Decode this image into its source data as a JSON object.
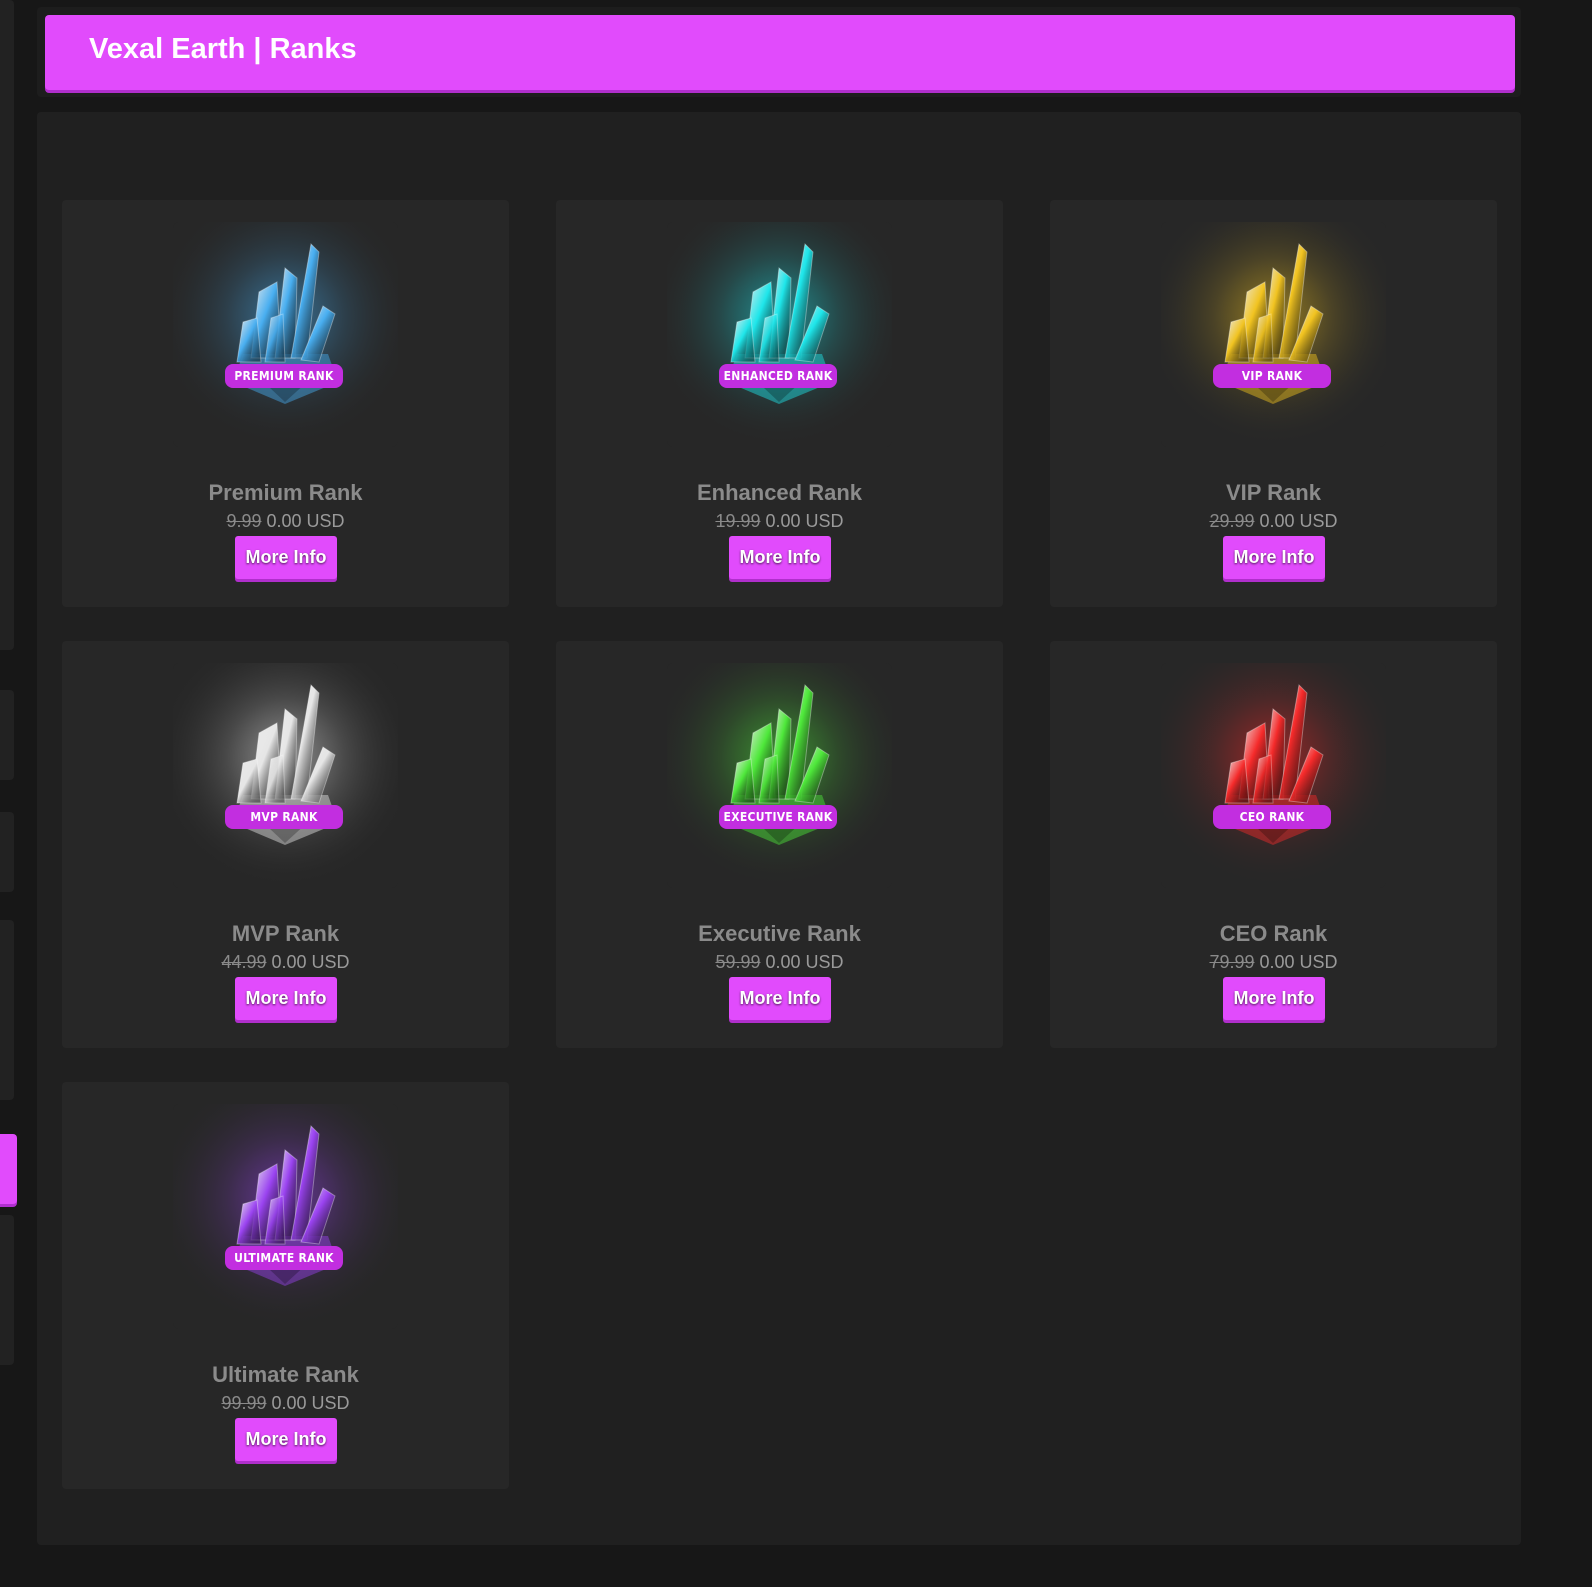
{
  "header": {
    "title": "Vexal Earth | Ranks"
  },
  "theme": {
    "accent": "#e14bfc",
    "card_bg": "#272727",
    "panel_bg": "#202020",
    "page_bg": "#171717"
  },
  "ranks": [
    {
      "name": "Premium Rank",
      "badge": "PREMIUM RANK",
      "old_price": "9.99",
      "price": "0.00 USD",
      "button": "More Info",
      "color": "#48aef0",
      "icon": "crystal-icon"
    },
    {
      "name": "Enhanced Rank",
      "badge": "ENHANCED RANK",
      "old_price": "19.99",
      "price": "0.00 USD",
      "button": "More Info",
      "color": "#1ee6ea",
      "icon": "crystal-icon"
    },
    {
      "name": "VIP Rank",
      "badge": "VIP RANK",
      "old_price": "29.99",
      "price": "0.00 USD",
      "button": "More Info",
      "color": "#f1c320",
      "icon": "crystal-icon"
    },
    {
      "name": "MVP Rank",
      "badge": "MVP RANK",
      "old_price": "44.99",
      "price": "0.00 USD",
      "button": "More Info",
      "color": "#e6e6e6",
      "icon": "crystal-icon"
    },
    {
      "name": "Executive Rank",
      "badge": "EXECUTIVE RANK",
      "old_price": "59.99",
      "price": "0.00 USD",
      "button": "More Info",
      "color": "#4ee83a",
      "icon": "crystal-icon"
    },
    {
      "name": "CEO Rank",
      "badge": "CEO RANK",
      "old_price": "79.99",
      "price": "0.00 USD",
      "button": "More Info",
      "color": "#f52a2a",
      "icon": "crystal-icon"
    },
    {
      "name": "Ultimate Rank",
      "badge": "ULTIMATE RANK",
      "old_price": "99.99",
      "price": "0.00 USD",
      "button": "More Info",
      "color": "#9a43f0",
      "icon": "crystal-icon"
    }
  ]
}
